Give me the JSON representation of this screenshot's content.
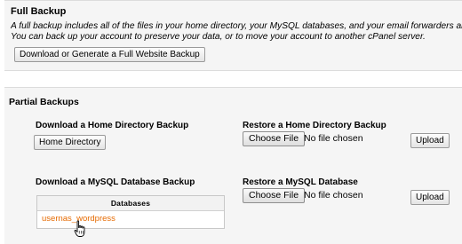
{
  "full_backup": {
    "title": "Full Backup",
    "description_line1": "A full backup includes all of the files in your home directory, your MySQL databases, and your email forwarders and",
    "description_line2": "You can back up your account to preserve your data, or to move your account to another cPanel server.",
    "button_label": "Download or Generate a Full Website Backup"
  },
  "partial_backups": {
    "title": "Partial Backups",
    "home_download": {
      "heading": "Download a Home Directory Backup",
      "button_label": "Home Directory"
    },
    "home_restore": {
      "heading": "Restore a Home Directory Backup",
      "choose_file_label": "Choose File",
      "status": "No file chosen",
      "upload_label": "Upload"
    },
    "mysql_download": {
      "heading": "Download a  MySQL Database Backup",
      "table_header": "Databases",
      "databases": [
        "usernas_wordpress"
      ]
    },
    "mysql_restore": {
      "heading": "Restore a MySQL Database",
      "choose_file_label": "Choose File",
      "status": "No file chosen",
      "upload_label": "Upload"
    }
  },
  "icons": {
    "cursor": "hand-pointer-icon"
  },
  "colors": {
    "link": "#e66a00",
    "panel_bg": "#f5f5f5"
  }
}
